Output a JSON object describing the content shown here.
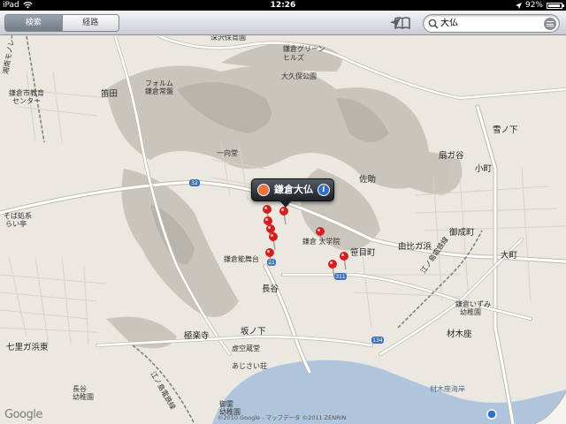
{
  "status_bar": {
    "device": "iPad",
    "time": "12:26",
    "battery_percent": "92%"
  },
  "toolbar": {
    "tabs": [
      {
        "label": "検索",
        "selected": true
      },
      {
        "label": "経路",
        "selected": false
      }
    ],
    "search_value": "大仏"
  },
  "callout": {
    "title": "鎌倉大仏"
  },
  "map_labels": {
    "fukazawa_school": "深沢保育園",
    "kamakura_green": "鎌倉グリーン",
    "hills": "ヒルズ",
    "okubo_koen": "大久保公園",
    "forum": "フォルム",
    "kamakura_jozo": "鎌倉常盤",
    "kamakura_edu1": "鎌倉市教育",
    "kamakura_edu2": "センター",
    "kasada": "笛田",
    "yukinoshita": "雪ノ下",
    "ogigayatsu": "扇ガ谷",
    "komachi": "小町",
    "sasuke": "佐助",
    "kamakura_gakuin": "鎌倉 大学院",
    "kamakura_noh": "鎌倉能舞台",
    "yuigahama": "由比ガ浜",
    "onarimachi": "御成町",
    "sasamemachi": "笹目町",
    "omachi": "大町",
    "hase": "長谷",
    "sakanoshita": "坂ノ下",
    "gokurakuji": "極楽寺",
    "shichirigahama": "七里ガ浜東",
    "hanase": "花の宝",
    "kamakura_izumi1": "鎌倉いずみ",
    "kamakura_izumi2": "幼稚園",
    "zaimokuza": "材木座",
    "zaimoku_kaigan": "材木座海岸",
    "sobajima1": "そば処系",
    "sobajima2": "らい亭",
    "hikarigaoka": "一向堂",
    "ajisaitei": "あじさい荘",
    "kokozo": "虚空蔵堂",
    "kanagawa_enoden": "江ノ島電鉄線",
    "kanagawa_enoden2": "江ノ島電鉄線",
    "mono_rail": "湘南モノレール",
    "hase_school1": "長谷",
    "hase_school2": "幼稚園",
    "yui_school1": "御霊",
    "yui_school2": "幼稚園",
    "route32": "32",
    "route311": "311",
    "route134": "134",
    "route21": "21"
  },
  "footer": {
    "logo": "Google",
    "copyright": "©2010 Google - マップデータ ©2011 ZENRIN"
  },
  "colors": {
    "land": "#ebe8e1",
    "hills": "#bdb9b0",
    "sea": "#aec5dc",
    "road": "#ffffff",
    "road_edge": "#bfbab0",
    "pin": "#d51f1f",
    "callout_bg": "#2a2e34",
    "info_blue": "#2f6fc9"
  },
  "icons": {
    "location": "location-arrow-icon",
    "bookmarks": "bookmarks-icon",
    "search": "magnifier-icon",
    "list": "list-icon",
    "person": "person-icon",
    "info": "info-icon",
    "pin": "map-pin-icon",
    "wifi": "wifi-icon"
  }
}
